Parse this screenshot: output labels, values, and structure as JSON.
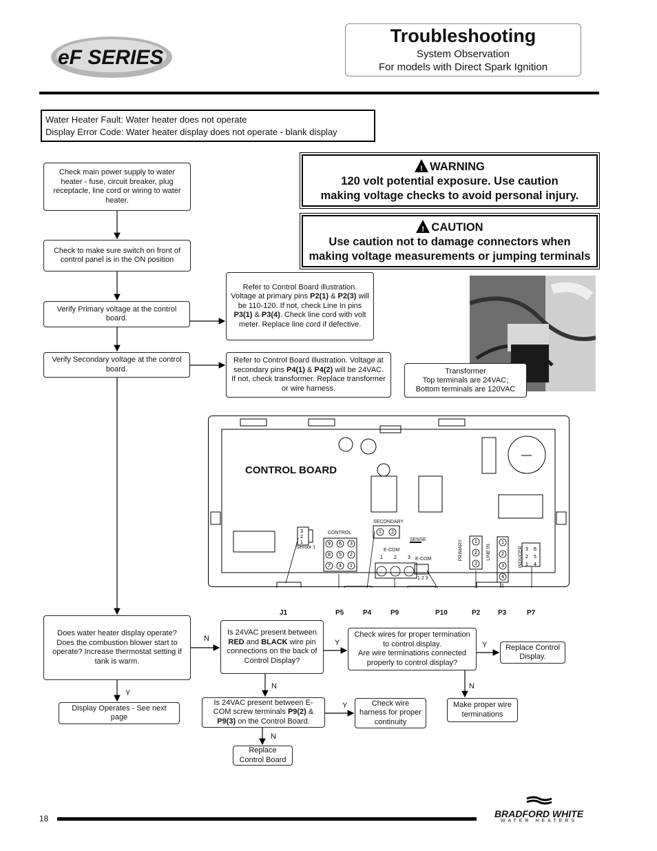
{
  "header": {
    "logo_text": "eF SERIES",
    "title": "Troubleshooting",
    "subtitle1": "System Observation",
    "subtitle2": "For models with Direct Spark Ignition"
  },
  "fault": {
    "line1": "Water Heater Fault: Water heater does not operate",
    "line2": "Display Error Code:  Water heater display does not operate - blank display"
  },
  "warning": {
    "icon": "warning-triangle-icon",
    "title": "WARNING",
    "line1": "120 volt potential exposure. Use caution",
    "line2": "making voltage checks to avoid personal injury."
  },
  "caution": {
    "icon": "warning-triangle-icon",
    "title": "CAUTION",
    "line1": "Use caution not to damage connectors when",
    "line2": "making voltage measurements or jumping terminals"
  },
  "flow": {
    "check_power": "Check main power supply to water heater - fuse, circuit breaker, plug receptacle, line cord or wiring to water heater.",
    "check_switch": "Check to make sure switch on front of control panel is in the ON position",
    "verify_primary": "Verify Primary voltage at the control board.",
    "verify_secondary": "Verify Secondary voltage at the control board.",
    "refer_primary": [
      "Refer to Control Board illustration. Voltage at primary pins ",
      "P2(1)",
      " & ",
      "P2(3)",
      " will be 110-120.  If not, check Line In pins ",
      "P3(1)",
      " & ",
      "P3(4)",
      ". Check line cord with volt meter.  Replace line cord if defective."
    ],
    "refer_secondary": [
      "Refer to Control Board illustration. Voltage at secondary pins ",
      "P4(1)",
      " & ",
      "P4(2)",
      " will be 24VAC. If not, check transformer.  Replace transformer or wire harness."
    ],
    "transformer": [
      "Transformer",
      "Top terminals are 24VAC;",
      "Bottom terminals are 120VAC"
    ],
    "display_operate": "Does water heater display operate? Does the combustion blower start to operate?  Increase thermostat setting if tank is warm.",
    "display_operates": "Display Operates - See next page",
    "red_black": [
      "Is 24VAC present between ",
      "RED",
      " and ",
      "BLACK",
      " wire pin connections on the back of Control Display?"
    ],
    "check_wires": [
      "Check wires for proper termination to control display.",
      "Are wire terminations connected properly to control display?"
    ],
    "replace_display": "Replace Control Display.",
    "make_proper": "Make proper wire terminations",
    "ecom": [
      "Is 24VAC present between E-COM screw terminals ",
      "P9(2)",
      " & ",
      "P9(3)",
      " on the Control Board."
    ],
    "check_harness": "Check wire harness for proper continuity",
    "replace_board": "Replace Control Board",
    "yes": "Y",
    "no": "N"
  },
  "board": {
    "title": "CONTROL BOARD",
    "sensor": "Sensor  1",
    "control": "CONTROL",
    "secondary": "SECONDARY",
    "sense": "SENSE",
    "ecom": "E-COM",
    "ecom_pins": "1 2 3",
    "primary": "PRIMARY",
    "line_in": "LINE IN",
    "inducer": "INDUCER",
    "control_pins": [
      "9",
      "6",
      "3",
      "8",
      "5",
      "2",
      "7",
      "4",
      "1"
    ],
    "connectors": [
      "J1",
      "P5",
      "P4",
      "P9",
      "P10",
      "P2",
      "P3",
      "P7"
    ]
  },
  "footer": {
    "page_number": "18",
    "brand": "BRADFORD WHITE",
    "brand_sub": "WATER HEATERS"
  }
}
